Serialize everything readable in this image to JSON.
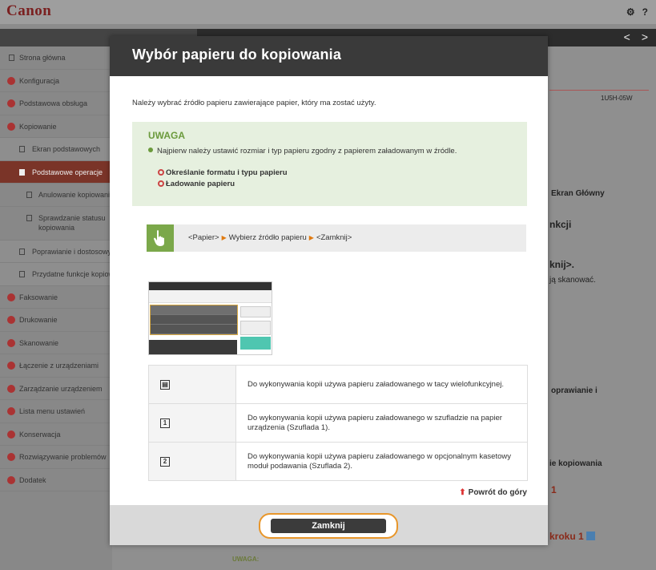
{
  "app": {
    "logo": "Canon",
    "settings_icon": "gear-icon",
    "help_icon": "question-icon",
    "help_glyph": "?"
  },
  "nav": {
    "prev_glyph": "<",
    "next_glyph": ">"
  },
  "sidebar": {
    "items": [
      {
        "label": "Strona główna",
        "icon": "square-icon"
      },
      {
        "label": "Konfiguracja",
        "icon": "bullet-icon"
      },
      {
        "label": "Podstawowa obsługa",
        "icon": "bullet-icon"
      },
      {
        "label": "Kopiowanie",
        "icon": "bullet-icon"
      },
      {
        "label": "Ekran podstawowych",
        "icon": "square-icon"
      },
      {
        "label": "Podstawowe operacje",
        "icon": "square-icon"
      },
      {
        "label": "Anulowanie kopiowania",
        "icon": "square-icon"
      },
      {
        "label": "Sprawdzanie statusu kopiowania",
        "icon": "square-icon"
      },
      {
        "label": "Poprawianie i dostosowywanie",
        "icon": "square-icon"
      },
      {
        "label": "Przydatne funkcje kopiowania",
        "icon": "square-icon"
      },
      {
        "label": "Faksowanie",
        "icon": "bullet-icon"
      },
      {
        "label": "Drukowanie",
        "icon": "bullet-icon"
      },
      {
        "label": "Skanowanie",
        "icon": "bullet-icon"
      },
      {
        "label": "Łączenie z urządzeniami",
        "icon": "bullet-icon"
      },
      {
        "label": "Zarządzanie urządzeniem",
        "icon": "bullet-icon"
      },
      {
        "label": "Lista menu ustawień",
        "icon": "bullet-icon"
      },
      {
        "label": "Konserwacja",
        "icon": "bullet-icon"
      },
      {
        "label": "Rozwiązywanie problemów",
        "icon": "bullet-icon"
      },
      {
        "label": "Dodatek",
        "icon": "bullet-icon"
      }
    ]
  },
  "background": {
    "model": "1U5H-05W",
    "home_screen": "Ekran Główny",
    "functions": "nkcji",
    "close_knij": "knij>.",
    "scan_text": "ją skanować.",
    "copy_adjust": "oprawianie i",
    "copy_label": "ie kopiowania",
    "step_fragment": "kroku 1",
    "step_num": "1",
    "uwaga_bg": "UWAGA:"
  },
  "modal": {
    "title": "Wybór papieru do kopiowania",
    "intro": "Należy wybrać źródło papieru zawierające papier, który ma zostać użyty.",
    "note": {
      "heading": "UWAGA",
      "text": "Najpierw należy ustawić rozmiar i typ papieru zgodny z papierem załadowanym w źródle.",
      "link1": "Określanie formatu i typu papieru",
      "link2": "Ładowanie papieru"
    },
    "path": {
      "step1": "<Papier>",
      "step2": "Wybierz źródło papieru",
      "step3": "<Zamknij>",
      "arrow": "▶"
    },
    "sources": [
      {
        "icon": "multipurpose-tray-icon",
        "glyph": "▤",
        "text": "Do wykonywania kopii używa papieru załadowanego w tacy wielofunkcyjnej."
      },
      {
        "icon": "drawer-1-icon",
        "glyph": "1",
        "text": "Do wykonywania kopii używa papieru załadowanego w szufladzie na papier urządzenia (Szuflada 1)."
      },
      {
        "icon": "drawer-2-icon",
        "glyph": "2",
        "text": "Do wykonywania kopii używa papieru załadowanego w opcjonalnym kasetowy moduł podawania (Szuflada 2)."
      }
    ],
    "back_to_top": "Powrót do góry",
    "close_button": "Zamknij"
  },
  "colors": {
    "header": "#3a3a3a",
    "note_bg": "#e6f0df",
    "note_accent": "#6b9a3c",
    "path_hand": "#7ba84a",
    "close_outline": "#e8962a",
    "link_ring": "#cc4444"
  }
}
